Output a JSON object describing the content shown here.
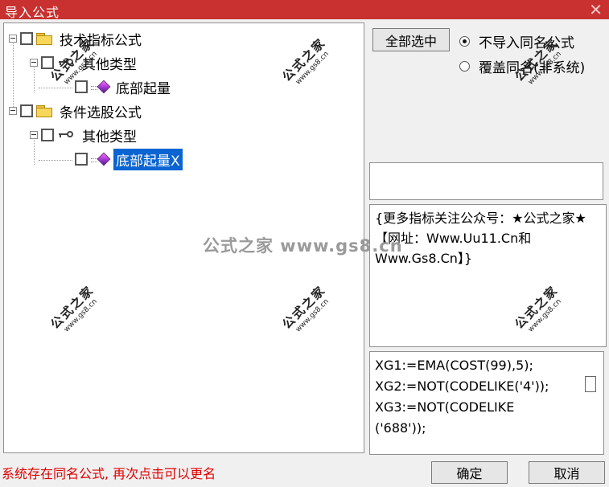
{
  "window": {
    "title": "导入公式",
    "close_label": "✕"
  },
  "tree": {
    "nodes": [
      {
        "label": "技术指标公式"
      },
      {
        "label": "其他类型"
      },
      {
        "label": "底部起量"
      },
      {
        "label": "条件选股公式"
      },
      {
        "label": "其他类型"
      },
      {
        "label": "底部起量X"
      }
    ]
  },
  "buttons": {
    "select_all": "全部选中",
    "ok": "确定",
    "cancel": "取消"
  },
  "options": {
    "no_import": {
      "label": "不导入同名公式",
      "checked": true
    },
    "overwrite": {
      "label": "覆盖同名(非系统)",
      "checked": false
    }
  },
  "description": {
    "text": "{更多指标关注公众号：★公式之家★ 【网址：Www.Uu11.Cn和Www.Gs8.Cn】}"
  },
  "code": {
    "lines": [
      "XG1:=EMA(COST(99),5);",
      "XG2:=NOT(CODELIKE('4'));",
      "XG3:=NOT(CODELIKE",
      "('688'));"
    ]
  },
  "status": {
    "message": "系统存在同名公式, 再次点击可以更名"
  },
  "watermark": {
    "title": "公式之家",
    "url": "www.gs8.cn",
    "center_text": "公式之家 www.gs8.cn"
  }
}
